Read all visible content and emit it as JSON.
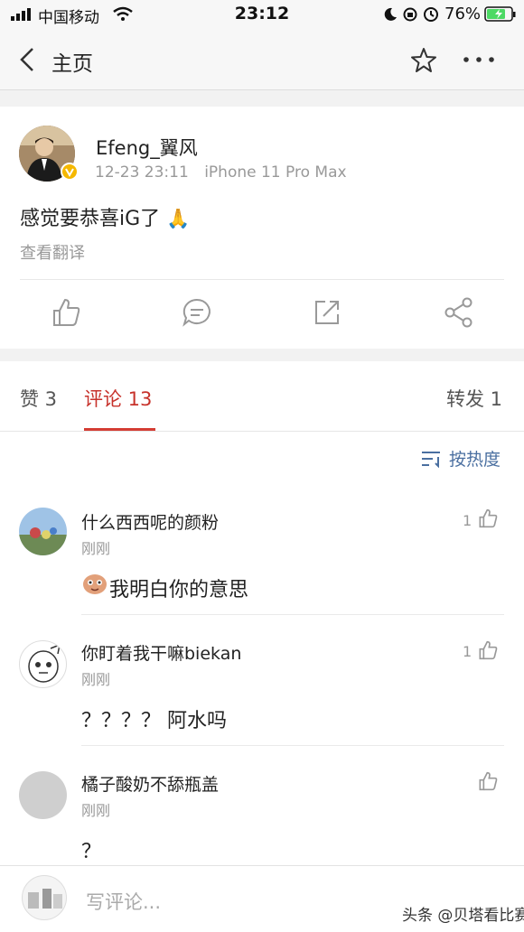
{
  "status_bar": {
    "carrier": "中国移动",
    "time": "23:12",
    "battery": "76%"
  },
  "nav": {
    "title": "主页",
    "back_icon": "chevron-left-icon",
    "star_icon": "star-icon",
    "more_icon": "more-horizontal-icon"
  },
  "post": {
    "author": "Efeng_翼风",
    "date": "12-23 23:11",
    "device": "iPhone 11 Pro Max",
    "text": "感觉要恭喜iG了",
    "emoji": "🙏",
    "translate_label": "查看翻译",
    "verified_color": "#f5b800"
  },
  "tabs": {
    "likes": "赞 3",
    "comments": "评论 13",
    "reposts": "转发 1",
    "accent_color": "#d43c33"
  },
  "comments": {
    "sort_label": "按热度",
    "items": [
      {
        "name": "什么西西呢的颜粉",
        "time": "刚刚",
        "text": "我明白你的意思",
        "likes": "1"
      },
      {
        "name": "你盯着我干嘛biekan",
        "time": "刚刚",
        "text": "？？？？ 阿水吗",
        "likes": "1"
      },
      {
        "name": "橘子酸奶不舔瓶盖",
        "time": "刚刚",
        "text": "？",
        "likes": ""
      }
    ]
  },
  "bottom": {
    "placeholder": "写评论...",
    "watermark": "头条 @贝塔看比赛"
  }
}
